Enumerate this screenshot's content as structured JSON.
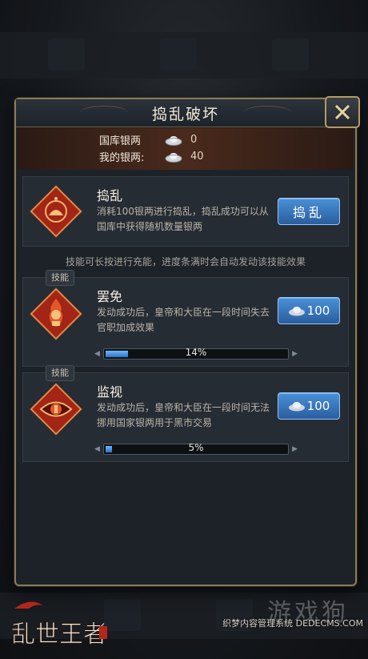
{
  "dialog": {
    "title": "捣乱破坏",
    "close_icon": "close-x-icon"
  },
  "silver": {
    "treasury_label": "国库银两",
    "treasury_value": "0",
    "mine_label": "我的银两:",
    "mine_value": "40",
    "icon": "silver-ingot-icon"
  },
  "skills": [
    {
      "name": "捣乱",
      "desc": "消耗100银两进行捣乱，捣乱成功可以从国库中获得随机数量银两",
      "button": "捣乱",
      "icon": "mischief-emblem-icon"
    },
    {
      "tag": "技能",
      "name": "罢免",
      "desc": "发动成功后，皇帝和大臣在一段时间失去官职加成效果",
      "button": "100",
      "progress_text": "14%",
      "progress": 0.14,
      "icon": "dismissal-emblem-icon"
    },
    {
      "tag": "技能",
      "name": "监视",
      "desc": "发动成功后，皇帝和大臣在一段时间无法挪用国家银两用于黑市交易",
      "button": "100",
      "progress_text": "5%",
      "progress": 0.05,
      "icon": "surveillance-eye-icon"
    }
  ],
  "hint": "技能可长按进行充能，进度条满时会自动发动该技能效果",
  "branding": {
    "logo_text": "乱世王者",
    "watermark": "游戏狗",
    "site": "织梦内容管理系统 DEDECMS.COM"
  },
  "colors": {
    "accent_blue": "#3b7bc4",
    "frame_gold": "#8b7a57",
    "emblem_red": "#a32516"
  }
}
